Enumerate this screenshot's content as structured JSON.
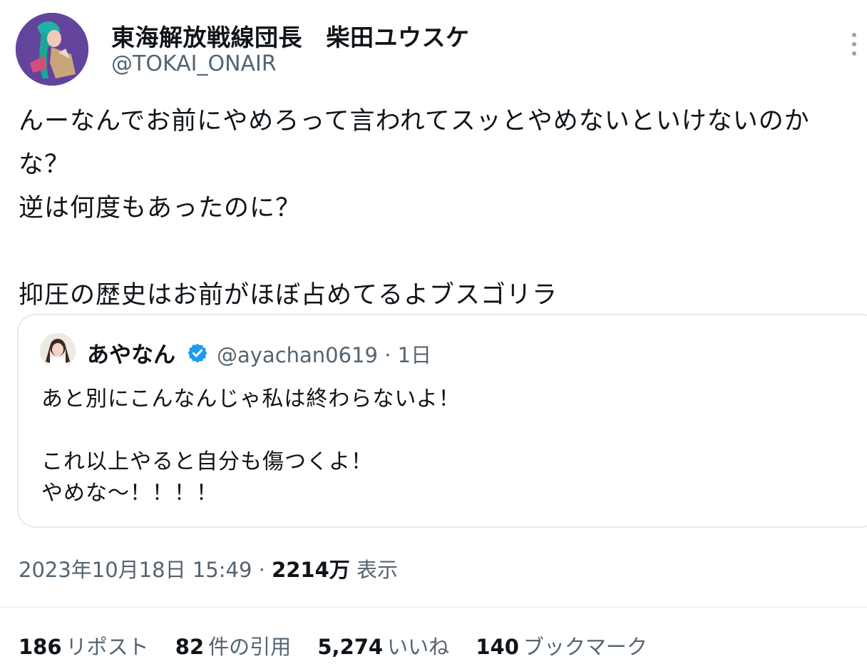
{
  "author": {
    "display_name": "東海解放戦線団長　柴田ユウスケ",
    "handle": "@TOKAI_ONAIR"
  },
  "tweet": {
    "text": "んーなんでお前にやめろって言われてスッとやめないといけないのかな？\n逆は何度もあったのに？\n\n抑圧の歴史はお前がほぼ占めてるよブスゴリラ"
  },
  "quote": {
    "name": "あやなん",
    "handle_time": "@ayachan0619 · 1日",
    "text": "あと別にこんなんじゃ私は終わらないよ！\n\nこれ以上やると自分も傷つくよ！\nやめな〜！！！！",
    "verified_color": "#1d9bf0"
  },
  "meta": {
    "datetime": "2023年10月18日 15:49 · ",
    "views_count": "2214万",
    "views_label": " 表示"
  },
  "stats": {
    "reposts": {
      "count": "186",
      "label": "リポスト"
    },
    "quotes": {
      "count": "82",
      "label": "件の引用"
    },
    "likes": {
      "count": "5,274",
      "label": "いいね"
    },
    "bookmarks": {
      "count": "140",
      "label": "ブックマーク"
    }
  }
}
